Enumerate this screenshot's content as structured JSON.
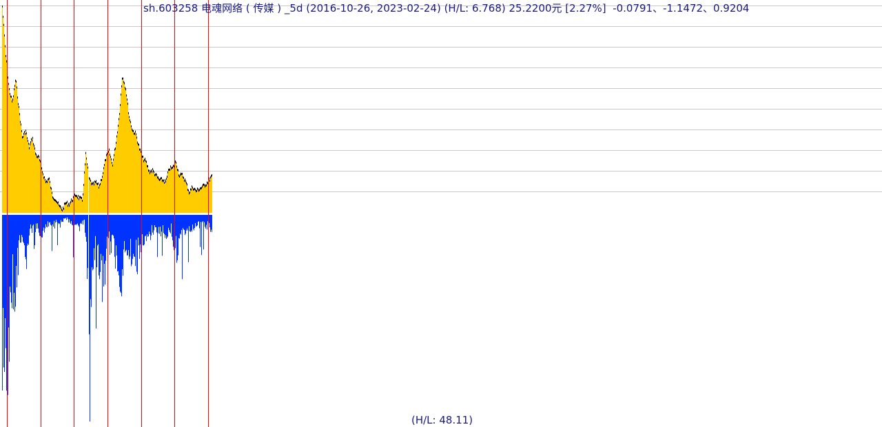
{
  "title": "sh.603258 电魂网络 ( 传媒 ) _5d (2016-10-26, 2023-02-24) (H/L: 6.768) 25.2200元 [2.27%]  -0.0791、-1.1472、0.9204",
  "volume_label": "(H/L: 48.11)",
  "colors": {
    "price_fill": "#ffcc00",
    "price_line": "#000000",
    "volume": "#0033ff",
    "marker_line": "#ff0000",
    "grid": "#c8c8c8",
    "text": "#1a1a80"
  },
  "chart_data": {
    "type": "area",
    "title": "sh.603258 电魂网络 ( 传媒 ) _5d (2016-10-26, 2023-02-24)",
    "date_range": [
      "2016-10-26",
      "2023-02-24"
    ],
    "price_high_low_ratio": 6.768,
    "last_price": 25.22,
    "last_change_pct": 2.27,
    "grid": true,
    "price_series": [
      86.3,
      68.8,
      56.4,
      51.4,
      60.1,
      48.9,
      38.9,
      41.4,
      35.2,
      38.9,
      32.7,
      31.4,
      26.5,
      22.7,
      24.0,
      17.7,
      16.5,
      14.0,
      12.75,
      15.2,
      14.7,
      16.5,
      18.2,
      17.0,
      16.0,
      32.7,
      24.0,
      21.5,
      22.7,
      21.0,
      25.2,
      31.4,
      33.9,
      29.0,
      36.4,
      46.4,
      61.4,
      56.4,
      46.4,
      41.4,
      40.2,
      35.2,
      31.4,
      30.2,
      26.5,
      27.0,
      25.2,
      23.5,
      23.5,
      22.7,
      27.7,
      27.7,
      30.2,
      25.2,
      25.2,
      22.7,
      19.0,
      21.0,
      19.5,
      20.2,
      21.0,
      22.0,
      23.5,
      25.2
    ],
    "volume_high_low_ratio": 48.11,
    "volume_series": [
      130,
      250,
      100,
      80,
      35,
      70,
      20,
      20,
      20,
      25,
      15,
      10,
      10,
      8,
      5,
      10,
      15,
      20,
      5,
      140,
      40,
      60,
      100,
      40,
      40,
      60,
      80,
      40,
      50,
      60,
      50,
      40,
      30,
      20,
      25,
      20,
      25,
      20,
      50,
      40,
      20,
      20,
      15,
      15,
      12,
      15,
      20
    ]
  }
}
